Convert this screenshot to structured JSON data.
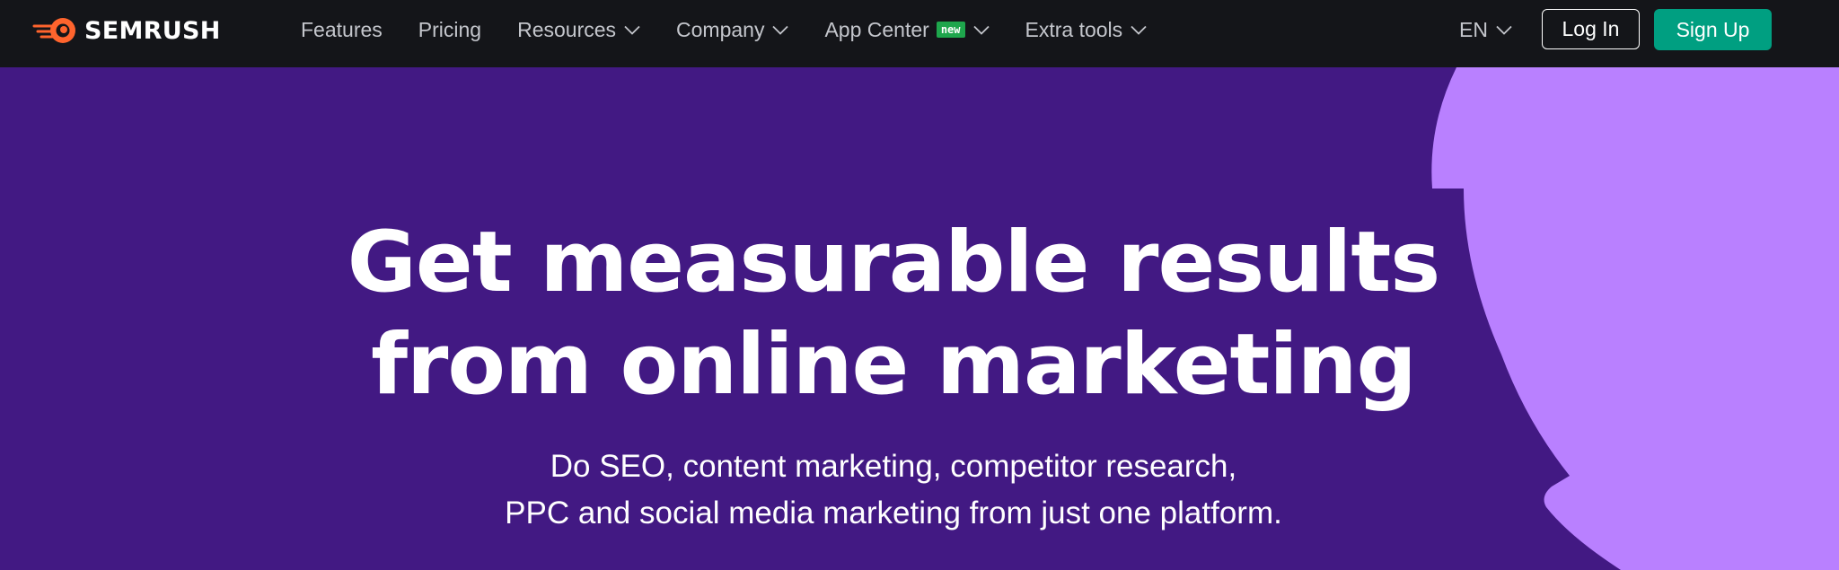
{
  "brand": {
    "name": "SEMRUSH",
    "logo_icon": "semrush-flame-icon",
    "colors": {
      "logo": "#ff642d",
      "topbar": "#141519",
      "hero_bg": "#421983",
      "hero_shape": "#b980ff",
      "signup": "#009f81",
      "badge": "#1ea64c"
    }
  },
  "nav": {
    "items": [
      {
        "label": "Features"
      },
      {
        "label": "Pricing"
      },
      {
        "label": "Resources",
        "icon": "chevron-down-icon"
      },
      {
        "label": "Company",
        "icon": "chevron-down-icon"
      },
      {
        "label": "App Center",
        "badge": "new",
        "icon": "chevron-down-icon"
      },
      {
        "label": "Extra tools",
        "icon": "chevron-down-icon"
      }
    ]
  },
  "header": {
    "language": "EN",
    "login_label": "Log In",
    "signup_label": "Sign Up"
  },
  "hero": {
    "title_line1": "Get measurable results",
    "title_line2": "from online marketing",
    "subtitle_line1": "Do SEO, content marketing, competitor research,",
    "subtitle_line2": "PPC and social media marketing from just one platform."
  }
}
